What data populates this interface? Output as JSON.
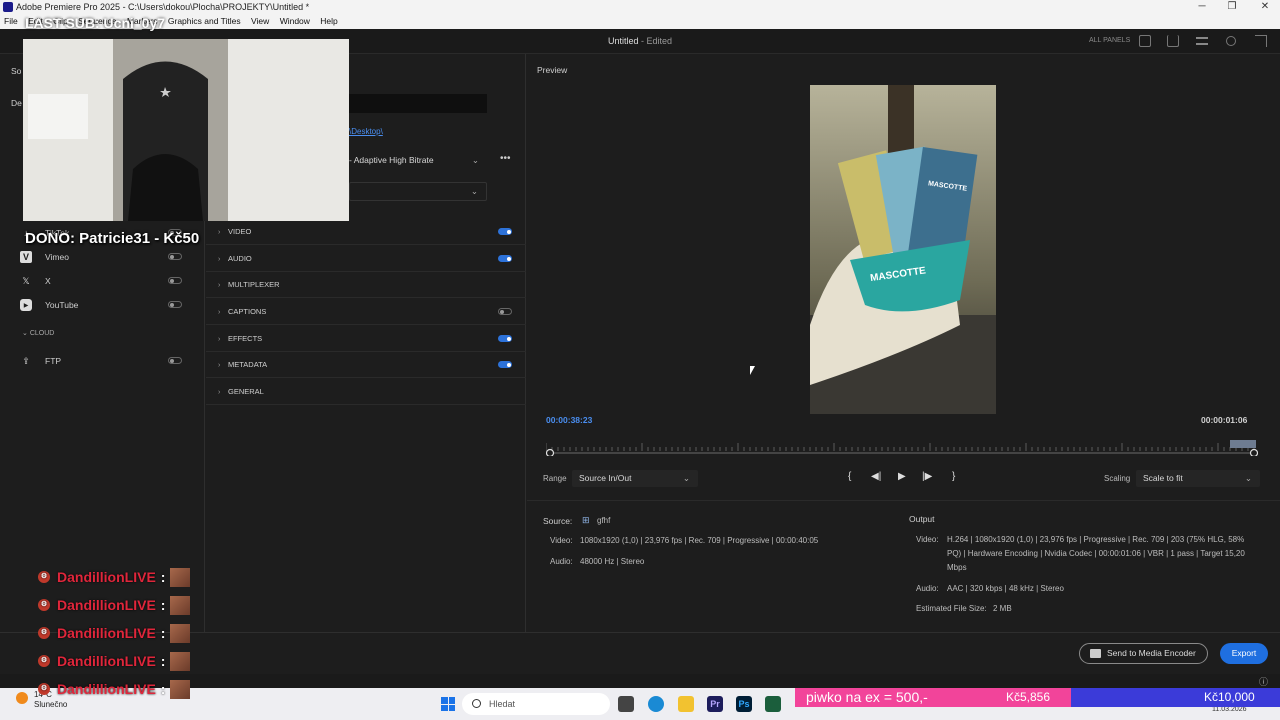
{
  "window": {
    "title": "Adobe Premiere Pro 2025 - C:\\Users\\dokou\\Plocha\\PROJEKTY\\Untitled *",
    "minimize": "─",
    "maximize": "❐",
    "close": "✕"
  },
  "menu": [
    "File",
    "Edit",
    "Clip",
    "Sequence",
    "Markers",
    "Graphics and Titles",
    "View",
    "Window",
    "Help"
  ],
  "header": {
    "doc_title": "Untitled",
    "doc_state": " - Edited",
    "all_panels": "ALL PANELS"
  },
  "left_panel": {
    "tab": "So",
    "section_label": "De",
    "destinations": [
      {
        "label": "TikTok",
        "icon": "tiktok-icon",
        "on": false
      },
      {
        "label": "Vimeo",
        "icon": "vimeo-icon",
        "on": false
      },
      {
        "label": "X",
        "icon": "x-icon",
        "on": false
      },
      {
        "label": "YouTube",
        "icon": "youtube-icon",
        "on": false
      }
    ],
    "cloud_header": "CLOUD",
    "ftp": {
      "label": "FTP",
      "on": false
    }
  },
  "settings": {
    "location_link": "\\Desktop\\",
    "preset": "- Adaptive High Bitrate",
    "format": "",
    "sections": [
      {
        "label": "VIDEO",
        "toggle": true
      },
      {
        "label": "AUDIO",
        "toggle": true
      },
      {
        "label": "MULTIPLEXER",
        "toggle": null
      },
      {
        "label": "CAPTIONS",
        "toggle": false
      },
      {
        "label": "EFFECTS",
        "toggle": true
      },
      {
        "label": "METADATA",
        "toggle": true
      },
      {
        "label": "GENERAL",
        "toggle": null
      }
    ]
  },
  "preview": {
    "label": "Preview",
    "current_time": "00:00:38:23",
    "duration": "00:00:01:06",
    "range_label": "Range",
    "range_value": "Source In/Out",
    "scaling_label": "Scaling",
    "scaling_value": "Scale to fit",
    "frame_text_1": "MASCOTTE",
    "frame_text_2": "MASCOTTE"
  },
  "source": {
    "label": "Source:",
    "name": "gfhf",
    "video_label": "Video:",
    "video": "1080x1920 (1,0)  |  23,976 fps  |  Rec. 709  |  Progressive  |  00:00:40:05",
    "audio_label": "Audio:",
    "audio": "48000 Hz  |  Stereo"
  },
  "output": {
    "label": "Output",
    "video_label": "Video:",
    "video_line1": "H.264  |  1080x1920 (1,0)  |  23,976 fps  |  Progressive  |  Rec. 709  |  203 (75% HLG, 58%",
    "video_line2": "PQ)  |  Hardware Encoding  |  Nvidia Codec  |  00:00:01:06  |  VBR  |  1 pass  |  Target 15,20",
    "video_line3": "Mbps",
    "audio_label": "Audio:",
    "audio": "AAC  |  320 kbps  |  48 kHz  |  Stereo",
    "size_label": "Estimated File Size:",
    "size": "2 MB"
  },
  "buttons": {
    "send_to_encoder": "Send to Media Encoder",
    "export": "Export"
  },
  "stream_overlay": {
    "last_sub": "LAST SUB: Ucni_0y7",
    "dono": "DONO: Patricie31 - Kč50",
    "chat": [
      {
        "user": "DandillionLIVE",
        "sep": ":"
      },
      {
        "user": "DandillionLIVE",
        "sep": ":"
      },
      {
        "user": "DandillionLIVE",
        "sep": ":"
      },
      {
        "user": "DandillionLIVE",
        "sep": ":"
      },
      {
        "user": "DandillionLIVE",
        "sep": ":"
      }
    ],
    "goal_text": "piwko na ex = 500,-",
    "goal_current": "Kč5,856",
    "goal_target": "Kč10,000",
    "goal_progress": 0.57
  },
  "taskbar": {
    "weather_temp": "14°C",
    "weather_desc": "Slunečno",
    "search_placeholder": "Hledat",
    "apps": [
      "Pr",
      "Ps"
    ],
    "date": "11.03.2026"
  },
  "colors": {
    "accent": "#2d72d9",
    "export": "#1f6fe0",
    "timecode": "#4a8ef0",
    "chat_user": "#e0263b",
    "goal_pink": "#f2449a",
    "goal_blue": "#3b3bd9"
  }
}
